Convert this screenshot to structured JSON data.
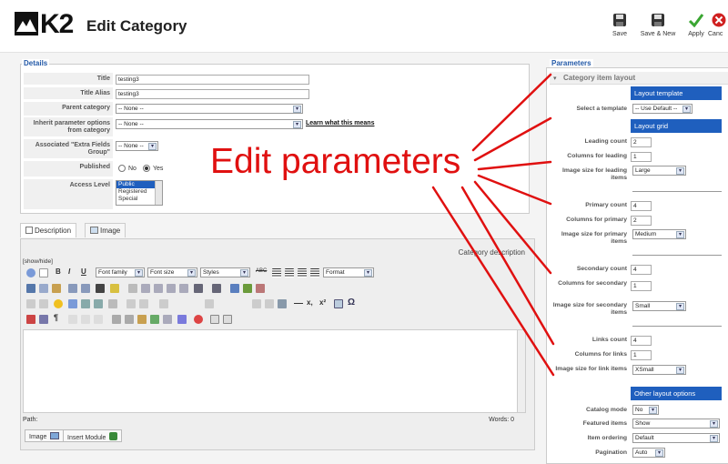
{
  "header": {
    "logo_text": "K2",
    "title": "Edit Category",
    "buttons": [
      {
        "label": "Save",
        "icon": "floppy-disk-icon"
      },
      {
        "label": "Save & New",
        "icon": "floppy-disk-icon"
      },
      {
        "label": "Apply",
        "icon": "checkmark-icon"
      },
      {
        "label": "Canc",
        "icon": "cancel-icon"
      }
    ]
  },
  "details": {
    "legend": "Details",
    "title_label": "Title",
    "title_value": "testing3",
    "alias_label": "Title Alias",
    "alias_value": "testing3",
    "parent_label": "Parent category",
    "parent_value": "-- None --",
    "inherit_label": "Inherit parameter options from category",
    "inherit_value": "-- None --",
    "learn_link": "Learn what this means",
    "extra_label": "Associated \"Extra Fields Group\"",
    "extra_value": "-- None --",
    "published_label": "Published",
    "published_no": "No",
    "published_yes": "Yes",
    "access_label": "Access Level",
    "access_options": [
      "Public",
      "Registered",
      "Special"
    ]
  },
  "tabs": {
    "description": "Description",
    "image": "Image"
  },
  "editor": {
    "caption": "Category description",
    "show_hide": "[show/hide]",
    "font_family": "Font family",
    "font_size": "Font size",
    "styles": "Styles",
    "format": "Format",
    "path_label": "Path:",
    "words": "Words: 0",
    "image_button": "Image",
    "insert_module_button": "Insert Module"
  },
  "parameters": {
    "legend": "Parameters",
    "section_title": "Category item layout",
    "layout_template_head": "Layout template",
    "select_template_label": "Select a template",
    "select_template_value": "-- Use Default --",
    "layout_grid_head": "Layout grid",
    "leading_count_label": "Leading count",
    "leading_count_value": "2",
    "columns_leading_label": "Columns for leading",
    "columns_leading_value": "1",
    "image_leading_label": "Image size for leading items",
    "image_leading_value": "Large",
    "primary_count_label": "Primary count",
    "primary_count_value": "4",
    "columns_primary_label": "Columns for primary",
    "columns_primary_value": "2",
    "image_primary_label": "Image size for primary items",
    "image_primary_value": "Medium",
    "secondary_count_label": "Secondary count",
    "secondary_count_value": "4",
    "columns_secondary_label": "Columns for secondary",
    "columns_secondary_value": "1",
    "image_secondary_label": "Image size for secondary items",
    "image_secondary_value": "Small",
    "links_count_label": "Links count",
    "links_count_value": "4",
    "columns_links_label": "Columns for links",
    "columns_links_value": "1",
    "image_links_label": "Image size for link items",
    "image_links_value": "XSmall",
    "other_layout_head": "Other layout options",
    "catalog_mode_label": "Catalog mode",
    "catalog_mode_value": "No",
    "featured_items_label": "Featured items",
    "featured_items_value": "Show",
    "item_ordering_label": "Item ordering",
    "item_ordering_value": "Default",
    "pagination_label": "Pagination",
    "pagination_value": "Auto"
  },
  "annotation": {
    "text": "Edit parameters",
    "color": "#e01010"
  },
  "colors": {
    "accent_blue": "#1f5fbe",
    "legend_blue": "#245aa8"
  }
}
